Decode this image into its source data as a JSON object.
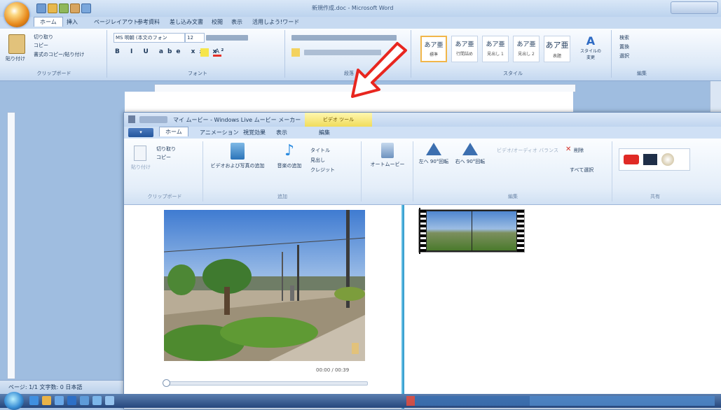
{
  "word": {
    "window_title": "新規作成.doc - Microsoft Word",
    "tabs": [
      "ホーム",
      "挿入",
      "ページレイアウト",
      "参考資料",
      "差し込み文書",
      "校閲",
      "表示",
      "活用しよう!ワード"
    ],
    "clipboard": {
      "paste": "貼り付け",
      "cut": "切り取り",
      "copy": "コピー",
      "format_painter": "書式のコピー/貼り付け",
      "group_label": "クリップボード"
    },
    "font": {
      "name": "MS 明朝 (本文のフォン",
      "size": "12",
      "group_label": "フォント"
    },
    "paragraph_group": "段落",
    "styles": [
      {
        "preview": "あア亜",
        "name": "標準"
      },
      {
        "preview": "あア亜",
        "name": "行間詰め"
      },
      {
        "preview": "あア亜",
        "name": "見出し 1"
      },
      {
        "preview": "あア亜",
        "name": "見出し 2"
      },
      {
        "preview": "あア亜",
        "name": "表題"
      }
    ],
    "styles_group": "スタイル",
    "change_styles": "スタイルの変更",
    "editing": {
      "find": "検索",
      "replace": "置換",
      "select": "選択",
      "group_label": "編集"
    },
    "status_text": "ページ: 1/1   文字数: 0   日本語"
  },
  "moviemaker": {
    "window_title": "マイ ムービー - Windows Live ムービー メーカー",
    "contextual_tab": "ビデオ ツール",
    "file_tab": "",
    "tabs": [
      "ホーム",
      "アニメーション",
      "視覚効果",
      "表示",
      "編集"
    ],
    "clipboard": {
      "paste": "貼り付け",
      "cut": "切り取り",
      "copy": "コピー",
      "group_label": "クリップボード"
    },
    "add": {
      "add_video_photo": "ビデオおよび写真の追加",
      "add_music": "音楽の追加",
      "title": "タイトル",
      "caption": "見出し",
      "credits": "クレジット",
      "group_label": "追加"
    },
    "automovie": "オートムービー",
    "edit": {
      "rotate_left": "左へ 90°回転",
      "rotate_right": "右へ 90°回転",
      "audio_mix": "ビデオ/オーディオ バランス",
      "remove": "削除",
      "select_all": "すべて選択",
      "group_label": "編集"
    },
    "share_group": "共有",
    "timecode": "00:00 / 00:39"
  },
  "colors": {
    "arrow": "#e8261f",
    "splitter": "#3aa9d8",
    "contextual_tab": "#f0dc5b"
  }
}
